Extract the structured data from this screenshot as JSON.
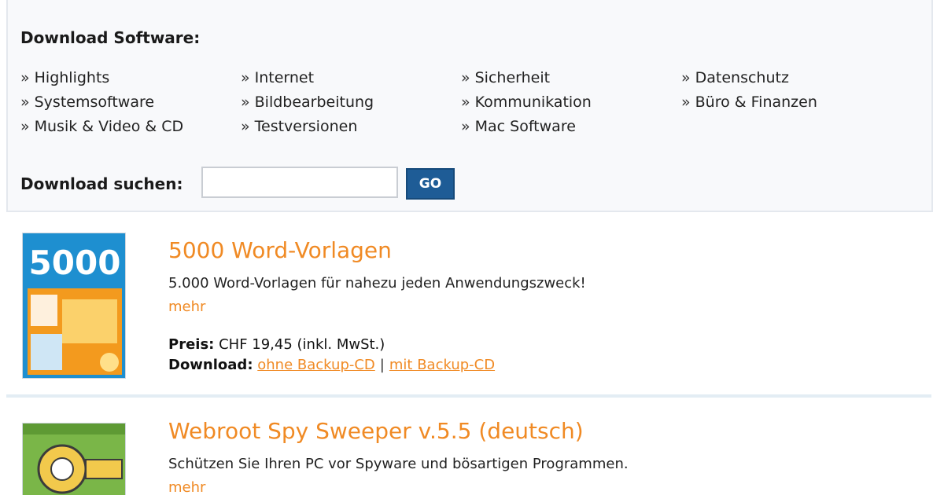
{
  "download_panel": {
    "title": "Download Software:",
    "categories": [
      {
        "label": "Highlights"
      },
      {
        "label": "Internet"
      },
      {
        "label": "Sicherheit"
      },
      {
        "label": "Datenschutz"
      },
      {
        "label": "Systemsoftware"
      },
      {
        "label": "Bildbearbeitung"
      },
      {
        "label": "Kommunikation"
      },
      {
        "label": "Büro & Finanzen"
      },
      {
        "label": "Musik & Video & CD"
      },
      {
        "label": "Testversionen"
      },
      {
        "label": "Mac Software"
      }
    ],
    "bullet": "»",
    "search": {
      "label": "Download suchen:",
      "value": "",
      "placeholder": "",
      "button_label": "GO"
    }
  },
  "products": [
    {
      "title": "5000 Word-Vorlagen",
      "description": "5.000 Word-Vorlagen für nahezu jeden Anwendungszweck!",
      "more_label": "mehr",
      "price_label": "Preis:",
      "price_value": "CHF 19,45 (inkl. MwSt.)",
      "download_label": "Download:",
      "download_links": [
        "ohne Backup-CD",
        "mit Backup-CD"
      ],
      "download_separator": "|",
      "image_text": "5000",
      "image_colors": {
        "top": "#1e8fd0",
        "bottom": "#f39a1e"
      }
    },
    {
      "title": "Webroot Spy Sweeper v.5.5 (deutsch)",
      "description": "Schützen Sie Ihren PC vor Spyware und bösartigen Programmen.",
      "more_label": "mehr",
      "image_colors": {
        "top": "#7ab648",
        "bottom": "#f2c94c"
      }
    }
  ],
  "colors": {
    "accent_orange": "#f08a24",
    "button_blue": "#1e5c96",
    "panel_bg": "#f8f9fb"
  }
}
